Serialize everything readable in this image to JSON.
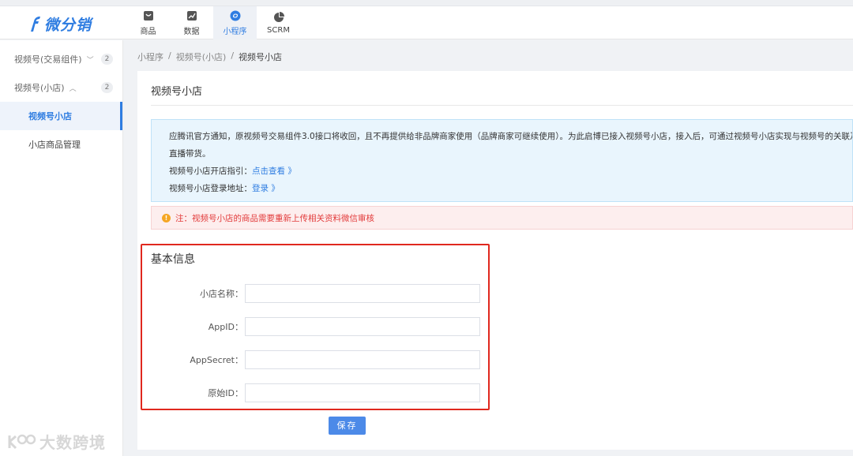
{
  "app": {
    "logo_text": "微分销",
    "brand_color": "#2f7de1"
  },
  "nav": [
    {
      "label": "商品",
      "icon": "product-icon",
      "active": false
    },
    {
      "label": "数据",
      "icon": "chart-icon",
      "active": false
    },
    {
      "label": "小程序",
      "icon": "mini-program-icon",
      "active": true
    },
    {
      "label": "SCRM",
      "icon": "pie-chart-icon",
      "active": false
    }
  ],
  "sidebar": {
    "groups": [
      {
        "label": "视频号(交易组件)",
        "badge": "2",
        "expanded": false
      },
      {
        "label": "视频号(小店)",
        "badge": "2",
        "expanded": true
      }
    ],
    "items": [
      {
        "label": "视频号小店",
        "active": true
      },
      {
        "label": "小店商品管理",
        "active": false
      }
    ]
  },
  "breadcrumb": {
    "parts": [
      "小程序",
      "视频号(小店)",
      "视频号小店"
    ],
    "separator": "/"
  },
  "panel": {
    "title": "视频号小店"
  },
  "notice": {
    "line1": "应腾讯官方通知，原视频号交易组件3.0接口将收回，且不再提供给非品牌商家使用（品牌商家可继续使用）。为此启博已接入视频号小店，接入后，可通过视频号小店实现与视频号的关联及",
    "line2": "直播带货。",
    "guide_label": "视频号小店开店指引：",
    "guide_link": "点击查看 》",
    "login_label": "视频号小店登录地址：",
    "login_link": "登录 》"
  },
  "warning": {
    "icon": "!",
    "text": "注：视频号小店的商品需要重新上传相关资料微信审核"
  },
  "form": {
    "section_title": "基本信息",
    "fields": [
      {
        "label": "小店名称：",
        "value": ""
      },
      {
        "label": "AppID：",
        "value": ""
      },
      {
        "label": "AppSecret：",
        "value": ""
      },
      {
        "label": "原始ID：",
        "value": ""
      }
    ],
    "save_label": "保存"
  },
  "watermark": {
    "text": "大数跨境"
  }
}
